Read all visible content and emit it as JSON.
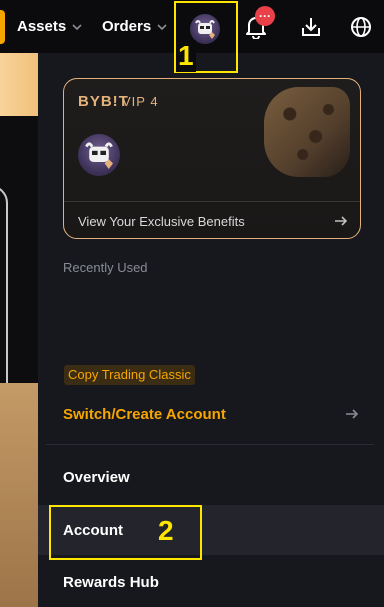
{
  "nav": {
    "assets_label": "Assets",
    "orders_label": "Orders",
    "notification_badge": "···",
    "accent": "#f7a600"
  },
  "annotations": {
    "step1": "1",
    "step2": "2",
    "highlight_color": "#ffe600"
  },
  "vip_card": {
    "logo": "BYB!T",
    "level": "VIP 4",
    "benefits_link": "View Your Exclusive Benefits",
    "border_color": "#e3b27c"
  },
  "panel": {
    "recently_used_label": "Recently Used",
    "account_tag": "Copy Trading Classic",
    "switch_account_label": "Switch/Create Account",
    "menu": [
      {
        "label": "Overview"
      },
      {
        "label": "Account"
      },
      {
        "label": "Rewards Hub"
      }
    ]
  },
  "icons": {
    "nav_chevron": "chevron-down-icon",
    "bell": "bell-icon",
    "download": "download-icon",
    "globe": "globe-icon",
    "arrow": "arrow-right-icon",
    "avatar": "bull-avatar-icon"
  }
}
